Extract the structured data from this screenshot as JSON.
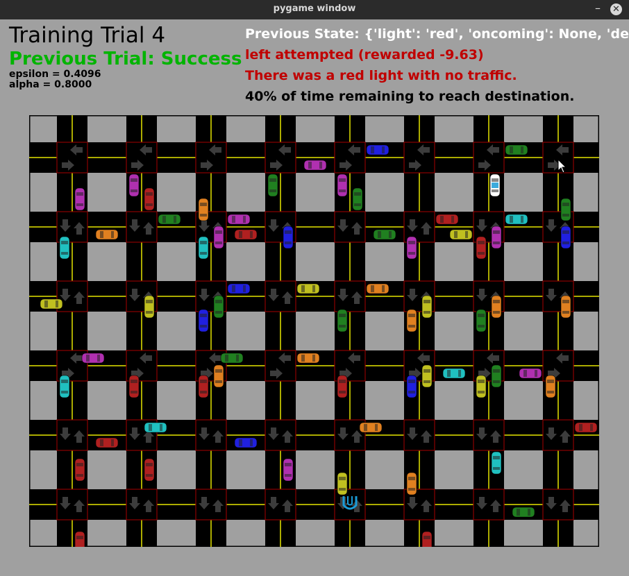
{
  "window": {
    "title": "pygame window",
    "minimize_glyph": "–",
    "close_glyph": "✕"
  },
  "hud": {
    "trial_title": "Training Trial 4",
    "previous_trial": "Previous Trial: Success",
    "epsilon": "epsilon = 0.4096",
    "alpha": "alpha = 0.8000",
    "previous_state": "Previous State: {'light': 'red', 'oncoming': None, 'deadline",
    "action": "left attempted (rewarded -9.63)",
    "reason": "There was a red light with no traffic.",
    "time_remaining": "40% of time remaining to reach destination."
  },
  "colors": {
    "background": "#a0a0a0",
    "road": "#000000",
    "lane_line": "#e6e600",
    "intersection_border": "#8b0000",
    "signal_arrow": "#3c3c3c",
    "success_text": "#00b400",
    "alert_text": "#c00000",
    "destination": "#1a9bd7",
    "agent": "#ffffff"
  },
  "icons": {
    "destination": "udacity-logo-icon",
    "agent": "white-smartcar-icon",
    "cursor": "mouse-pointer-icon"
  },
  "grid": {
    "columns": 8,
    "rows": 6
  },
  "cars": [
    {
      "color": "#b030b0",
      "col": 1,
      "row": 0,
      "dir": "v",
      "off": -1,
      "dist": 0.4
    },
    {
      "color": "#b030b0",
      "col": 4,
      "row": 0,
      "dir": "v",
      "off": -1,
      "dist": 0.4
    },
    {
      "color": "#208020",
      "col": 3,
      "row": 0,
      "dir": "v",
      "off": -1,
      "dist": 0.4
    },
    {
      "color": "#2020e0",
      "col": 4,
      "row": 0,
      "dir": "h",
      "off": -1,
      "dist": 0.4
    },
    {
      "color": "#b030b0",
      "col": 3,
      "row": 0,
      "dir": "h",
      "off": 1,
      "dist": 0.5
    },
    {
      "color": "#208020",
      "col": 6,
      "row": 0,
      "dir": "h",
      "off": -1,
      "dist": 0.4
    },
    {
      "color": "#b030b0",
      "col": 0,
      "row": 0,
      "dir": "v",
      "off": 1,
      "dist": 0.6
    },
    {
      "color": "#b02020",
      "col": 1,
      "row": 0,
      "dir": "v",
      "off": 1,
      "dist": 0.6
    },
    {
      "color": "#208020",
      "col": 4,
      "row": 0,
      "dir": "v",
      "off": 1,
      "dist": 0.6
    },
    {
      "color": "#208020",
      "col": 7,
      "row": 0,
      "dir": "v",
      "off": 1,
      "dist": 0.75
    },
    {
      "color": "#e08020",
      "col": 2,
      "row": 0,
      "dir": "v",
      "off": -1,
      "dist": 0.75
    },
    {
      "color": "#208020",
      "col": 1,
      "row": 1,
      "dir": "h",
      "off": -1,
      "dist": 0.4
    },
    {
      "color": "#e08020",
      "col": 0,
      "row": 1,
      "dir": "h",
      "off": 1,
      "dist": 0.5
    },
    {
      "color": "#b030b0",
      "col": 2,
      "row": 1,
      "dir": "h",
      "off": -1,
      "dist": 0.4
    },
    {
      "color": "#b02020",
      "col": 2,
      "row": 1,
      "dir": "h",
      "off": 1,
      "dist": 0.5
    },
    {
      "color": "#208020",
      "col": 4,
      "row": 1,
      "dir": "h",
      "off": 1,
      "dist": 0.5
    },
    {
      "color": "#b02020",
      "col": 5,
      "row": 1,
      "dir": "h",
      "off": -1,
      "dist": 0.4
    },
    {
      "color": "#c0c020",
      "col": 5,
      "row": 1,
      "dir": "h",
      "off": 1,
      "dist": 0.6
    },
    {
      "color": "#20c0c0",
      "col": 6,
      "row": 1,
      "dir": "h",
      "off": -1,
      "dist": 0.4
    },
    {
      "color": "#20c0c0",
      "col": 0,
      "row": 1,
      "dir": "v",
      "off": -1,
      "dist": 0.3
    },
    {
      "color": "#20c0c0",
      "col": 2,
      "row": 1,
      "dir": "v",
      "off": -1,
      "dist": 0.3
    },
    {
      "color": "#b030b0",
      "col": 2,
      "row": 1,
      "dir": "v",
      "off": 1,
      "dist": 0.15
    },
    {
      "color": "#2020e0",
      "col": 3,
      "row": 1,
      "dir": "v",
      "off": 1,
      "dist": 0.15
    },
    {
      "color": "#b030b0",
      "col": 5,
      "row": 1,
      "dir": "v",
      "off": -1,
      "dist": 0.3
    },
    {
      "color": "#b02020",
      "col": 6,
      "row": 1,
      "dir": "v",
      "off": -1,
      "dist": 0.3
    },
    {
      "color": "#b030b0",
      "col": 6,
      "row": 1,
      "dir": "v",
      "off": 1,
      "dist": 0.15
    },
    {
      "color": "#2020e0",
      "col": 7,
      "row": 1,
      "dir": "v",
      "off": 1,
      "dist": 0.15
    },
    {
      "color": "#c0c020",
      "col": -1,
      "row": 2,
      "dir": "h",
      "off": 1,
      "dist": 0.7
    },
    {
      "color": "#2020e0",
      "col": 2,
      "row": 2,
      "dir": "h",
      "off": -1,
      "dist": 0.4
    },
    {
      "color": "#c0c020",
      "col": 3,
      "row": 2,
      "dir": "h",
      "off": -1,
      "dist": 0.4
    },
    {
      "color": "#e08020",
      "col": 4,
      "row": 2,
      "dir": "h",
      "off": -1,
      "dist": 0.4
    },
    {
      "color": "#c0c020",
      "col": 1,
      "row": 2,
      "dir": "v",
      "off": 1,
      "dist": 0.15
    },
    {
      "color": "#208020",
      "col": 2,
      "row": 2,
      "dir": "v",
      "off": 1,
      "dist": 0.15
    },
    {
      "color": "#2020e0",
      "col": 2,
      "row": 2,
      "dir": "v",
      "off": -1,
      "dist": 0.35
    },
    {
      "color": "#208020",
      "col": 4,
      "row": 2,
      "dir": "v",
      "off": -1,
      "dist": 0.35
    },
    {
      "color": "#e08020",
      "col": 5,
      "row": 2,
      "dir": "v",
      "off": -1,
      "dist": 0.35
    },
    {
      "color": "#c0c020",
      "col": 5,
      "row": 2,
      "dir": "v",
      "off": 1,
      "dist": 0.15
    },
    {
      "color": "#208020",
      "col": 6,
      "row": 2,
      "dir": "v",
      "off": -1,
      "dist": 0.35
    },
    {
      "color": "#e08020",
      "col": 6,
      "row": 2,
      "dir": "v",
      "off": 1,
      "dist": 0.15
    },
    {
      "color": "#e08020",
      "col": 7,
      "row": 2,
      "dir": "v",
      "off": 1,
      "dist": 0.15
    },
    {
      "color": "#b030b0",
      "col": 0,
      "row": 3,
      "dir": "h",
      "off": -1,
      "dist": 0.3
    },
    {
      "color": "#208020",
      "col": 2,
      "row": 3,
      "dir": "h",
      "off": -1,
      "dist": 0.3
    },
    {
      "color": "#e08020",
      "col": 3,
      "row": 3,
      "dir": "h",
      "off": -1,
      "dist": 0.4
    },
    {
      "color": "#20c0c0",
      "col": 5,
      "row": 3,
      "dir": "h",
      "off": 1,
      "dist": 0.5
    },
    {
      "color": "#b030b0",
      "col": 6,
      "row": 3,
      "dir": "h",
      "off": 1,
      "dist": 0.6
    },
    {
      "color": "#20c0c0",
      "col": 0,
      "row": 3,
      "dir": "v",
      "off": -1,
      "dist": 0.3
    },
    {
      "color": "#b02020",
      "col": 1,
      "row": 3,
      "dir": "v",
      "off": -1,
      "dist": 0.3
    },
    {
      "color": "#b02020",
      "col": 2,
      "row": 3,
      "dir": "v",
      "off": -1,
      "dist": 0.3
    },
    {
      "color": "#e08020",
      "col": 2,
      "row": 3,
      "dir": "v",
      "off": 1,
      "dist": 0.15
    },
    {
      "color": "#b02020",
      "col": 4,
      "row": 3,
      "dir": "v",
      "off": -1,
      "dist": 0.3
    },
    {
      "color": "#2020e0",
      "col": 5,
      "row": 3,
      "dir": "v",
      "off": -1,
      "dist": 0.3
    },
    {
      "color": "#c0c020",
      "col": 5,
      "row": 3,
      "dir": "v",
      "off": 1,
      "dist": 0.15
    },
    {
      "color": "#c0c020",
      "col": 6,
      "row": 3,
      "dir": "v",
      "off": -1,
      "dist": 0.3
    },
    {
      "color": "#208020",
      "col": 6,
      "row": 3,
      "dir": "v",
      "off": 1,
      "dist": 0.15
    },
    {
      "color": "#e08020",
      "col": 7,
      "row": 3,
      "dir": "v",
      "off": -1,
      "dist": 0.3
    },
    {
      "color": "#20c0c0",
      "col": 1,
      "row": 4,
      "dir": "h",
      "off": -1,
      "dist": 0.2
    },
    {
      "color": "#b02020",
      "col": 0,
      "row": 4,
      "dir": "h",
      "off": 1,
      "dist": 0.5
    },
    {
      "color": "#2020e0",
      "col": 2,
      "row": 4,
      "dir": "h",
      "off": 1,
      "dist": 0.5
    },
    {
      "color": "#e08020",
      "col": 4,
      "row": 4,
      "dir": "h",
      "off": -1,
      "dist": 0.3
    },
    {
      "color": "#b02020",
      "col": 7,
      "row": 4,
      "dir": "h",
      "off": -1,
      "dist": 0.4
    },
    {
      "color": "#b02020",
      "col": 0,
      "row": 4,
      "dir": "v",
      "off": 1,
      "dist": 0.5
    },
    {
      "color": "#b02020",
      "col": 1,
      "row": 4,
      "dir": "v",
      "off": 1,
      "dist": 0.5
    },
    {
      "color": "#b030b0",
      "col": 3,
      "row": 4,
      "dir": "v",
      "off": 1,
      "dist": 0.5
    },
    {
      "color": "#c0c020",
      "col": 4,
      "row": 4,
      "dir": "v",
      "off": -1,
      "dist": 0.7
    },
    {
      "color": "#e08020",
      "col": 5,
      "row": 4,
      "dir": "v",
      "off": -1,
      "dist": 0.7
    },
    {
      "color": "#20c0c0",
      "col": 6,
      "row": 4,
      "dir": "v",
      "off": 1,
      "dist": 0.4
    },
    {
      "color": "#208020",
      "col": 6,
      "row": 5,
      "dir": "h",
      "off": 1,
      "dist": 0.5
    },
    {
      "color": "#b02020",
      "col": 0,
      "row": 5,
      "dir": "v",
      "off": 1,
      "dist": 0.55
    },
    {
      "color": "#b02020",
      "col": 5,
      "row": 5,
      "dir": "v",
      "off": 1,
      "dist": 0.55
    }
  ]
}
